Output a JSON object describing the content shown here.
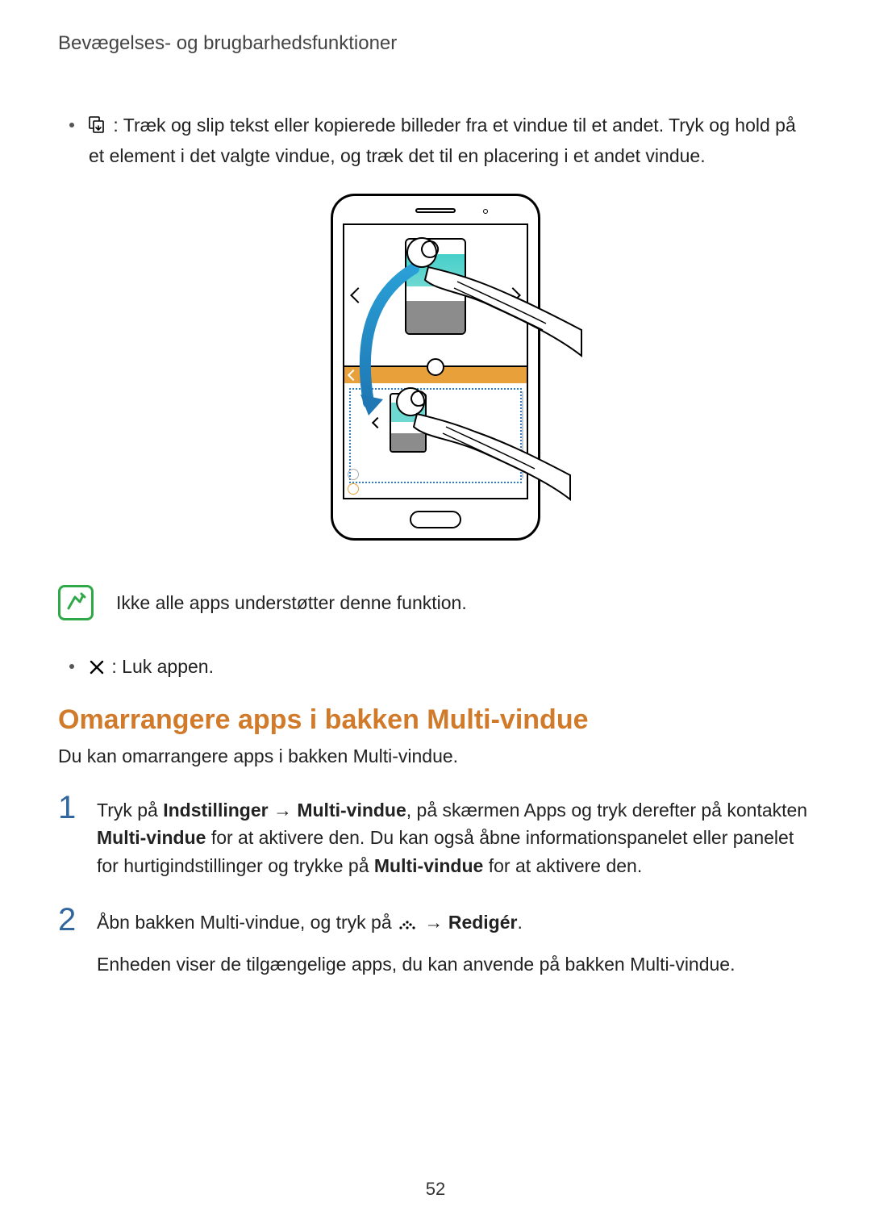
{
  "header": "Bevægelses- og brugbarhedsfunktioner",
  "bullet1": {
    "text_after_icon": " : Træk og slip tekst eller kopierede billeder fra et vindue til et andet. Tryk og hold på et element i det valgte vindue, og træk det til en placering i et andet vindue."
  },
  "note": "Ikke alle apps understøtter denne funktion.",
  "bullet2": {
    "text_after_icon": " : Luk appen."
  },
  "section": {
    "title": "Omarrangere apps i bakken Multi-vindue",
    "intro": "Du kan omarrangere apps i bakken Multi-vindue."
  },
  "steps": [
    {
      "num": "1",
      "pre": "Tryk på ",
      "b1": "Indstillinger",
      "sep1": " → ",
      "b2": "Multi-vindue",
      "post1": ", på skærmen Apps og tryk derefter på kontakten ",
      "b3": "Multi-vindue",
      "post2": " for at aktivere den. Du kan også åbne informationspanelet eller panelet for hurtigindstillinger og trykke på ",
      "b4": "Multi-vindue",
      "post3": " for at aktivere den."
    },
    {
      "num": "2",
      "pre": "Åbn bakken Multi-vindue, og tryk på ",
      "sep1": " → ",
      "b1": "Redigér",
      "post1": ".",
      "line2": "Enheden viser de tilgængelige apps, du kan anvende på bakken Multi-vindue."
    }
  ],
  "page_number": "52"
}
